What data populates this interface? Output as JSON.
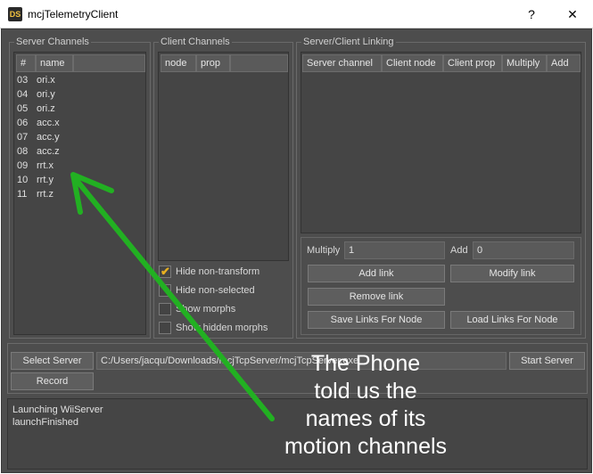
{
  "window": {
    "title": "mcjTelemetryClient",
    "app_icon_text": "DS",
    "help_label": "?",
    "close_label": "✕"
  },
  "server_channels": {
    "label": "Server Channels",
    "columns": [
      "#",
      "name"
    ],
    "rows": [
      {
        "num": "03",
        "name": "ori.x"
      },
      {
        "num": "04",
        "name": "ori.y"
      },
      {
        "num": "05",
        "name": "ori.z"
      },
      {
        "num": "06",
        "name": "acc.x"
      },
      {
        "num": "07",
        "name": "acc.y"
      },
      {
        "num": "08",
        "name": "acc.z"
      },
      {
        "num": "09",
        "name": "rrt.x"
      },
      {
        "num": "10",
        "name": "rrt.y"
      },
      {
        "num": "11",
        "name": "rrt.z"
      }
    ]
  },
  "client_channels": {
    "label": "Client Channels",
    "columns": [
      "node",
      "prop"
    ],
    "checkboxes": [
      {
        "label": "Hide non-transform",
        "checked": true
      },
      {
        "label": "Hide non-selected",
        "checked": false
      },
      {
        "label": "Show morphs",
        "checked": false
      },
      {
        "label": "Show hidden morphs",
        "checked": false
      }
    ]
  },
  "linking": {
    "label": "Server/Client Linking",
    "columns": [
      "Server channel",
      "Client node",
      "Client prop",
      "Multiply",
      "Add"
    ],
    "multiply_label": "Multiply",
    "multiply_value": "1",
    "add_label": "Add",
    "add_value": "0",
    "add_link": "Add link",
    "modify_link": "Modify link",
    "remove_link": "Remove link",
    "save_links": "Save Links For Node",
    "load_links": "Load Links For Node"
  },
  "server": {
    "select_label": "Select Server",
    "path_value": "C:/Users/jacqu/Downloads/mcjTcpServer/mcjTcpServer.exe",
    "start_label": "Start Server",
    "record_label": "Record"
  },
  "log": {
    "lines": [
      "Launching WiiServer",
      "launchFinished"
    ]
  },
  "annotation": {
    "lines": [
      "The Phone",
      "told us the",
      "names of its",
      "motion channels"
    ],
    "arrow_color": "#22b022"
  }
}
